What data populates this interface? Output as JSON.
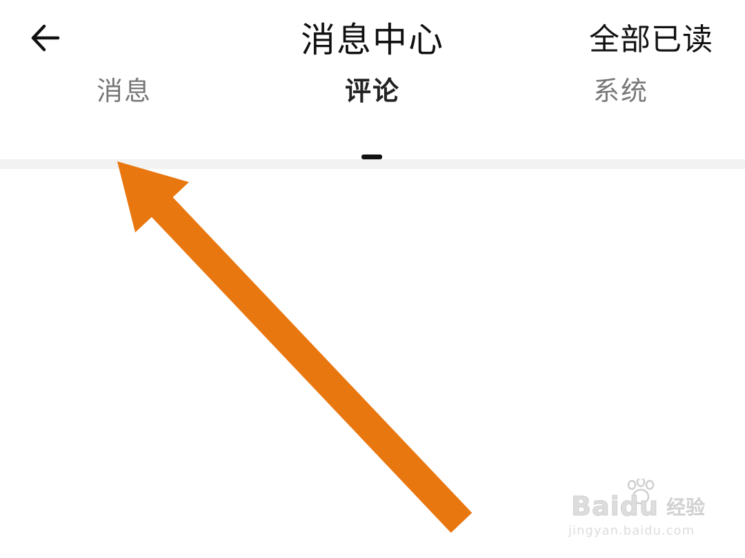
{
  "header": {
    "back_icon": "arrow-left-icon",
    "title": "消息中心",
    "mark_all_read_label": "全部已读"
  },
  "tabs": {
    "items": [
      {
        "label": "消息",
        "active": false
      },
      {
        "label": "评论",
        "active": true
      },
      {
        "label": "系统",
        "active": false
      }
    ]
  },
  "annotation": {
    "arrow_color": "#E97710",
    "arrow_icon": "pointing-arrow"
  },
  "watermark": {
    "brand": "Baidu",
    "brand_cn": "经验",
    "url": "jingyan.baidu.com"
  },
  "colors": {
    "text_primary": "#111111",
    "tab_inactive": "#777777",
    "divider": "#f2f2f2",
    "arrow": "#E97710"
  }
}
